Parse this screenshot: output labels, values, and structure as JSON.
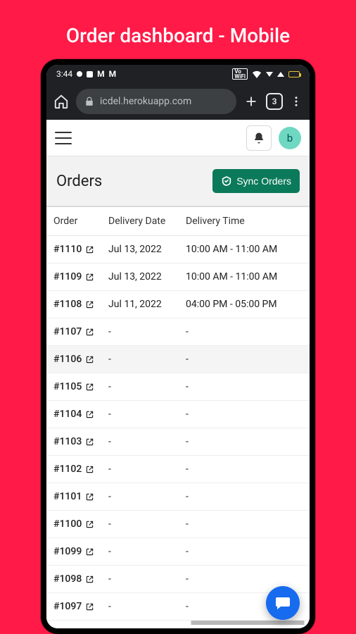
{
  "slide": {
    "title": "Order dashboard - Mobile"
  },
  "status_bar": {
    "time": "3:44"
  },
  "browser": {
    "url_display": "icdel.herokuapp.com",
    "tab_count": "3"
  },
  "app_header": {
    "avatar_initial": "b"
  },
  "page": {
    "title": "Orders",
    "sync_label": "Sync Orders"
  },
  "table": {
    "headers": {
      "order": "Order",
      "date": "Delivery Date",
      "time": "Delivery Time"
    },
    "rows": [
      {
        "order": "#1110",
        "date": "Jul 13, 2022",
        "time": "10:00 AM - 11:00 AM"
      },
      {
        "order": "#1109",
        "date": "Jul 13, 2022",
        "time": "10:00 AM - 11:00 AM"
      },
      {
        "order": "#1108",
        "date": "Jul 11, 2022",
        "time": "04:00 PM - 05:00 PM"
      },
      {
        "order": "#1107",
        "date": "-",
        "time": "-"
      },
      {
        "order": "#1106",
        "date": "-",
        "time": "-"
      },
      {
        "order": "#1105",
        "date": "-",
        "time": "-"
      },
      {
        "order": "#1104",
        "date": "-",
        "time": "-"
      },
      {
        "order": "#1103",
        "date": "-",
        "time": "-"
      },
      {
        "order": "#1102",
        "date": "-",
        "time": "-"
      },
      {
        "order": "#1101",
        "date": "-",
        "time": "-"
      },
      {
        "order": "#1100",
        "date": "-",
        "time": "-"
      },
      {
        "order": "#1099",
        "date": "-",
        "time": "-"
      },
      {
        "order": "#1098",
        "date": "-",
        "time": "-"
      },
      {
        "order": "#1097",
        "date": "-",
        "time": "-"
      }
    ]
  }
}
